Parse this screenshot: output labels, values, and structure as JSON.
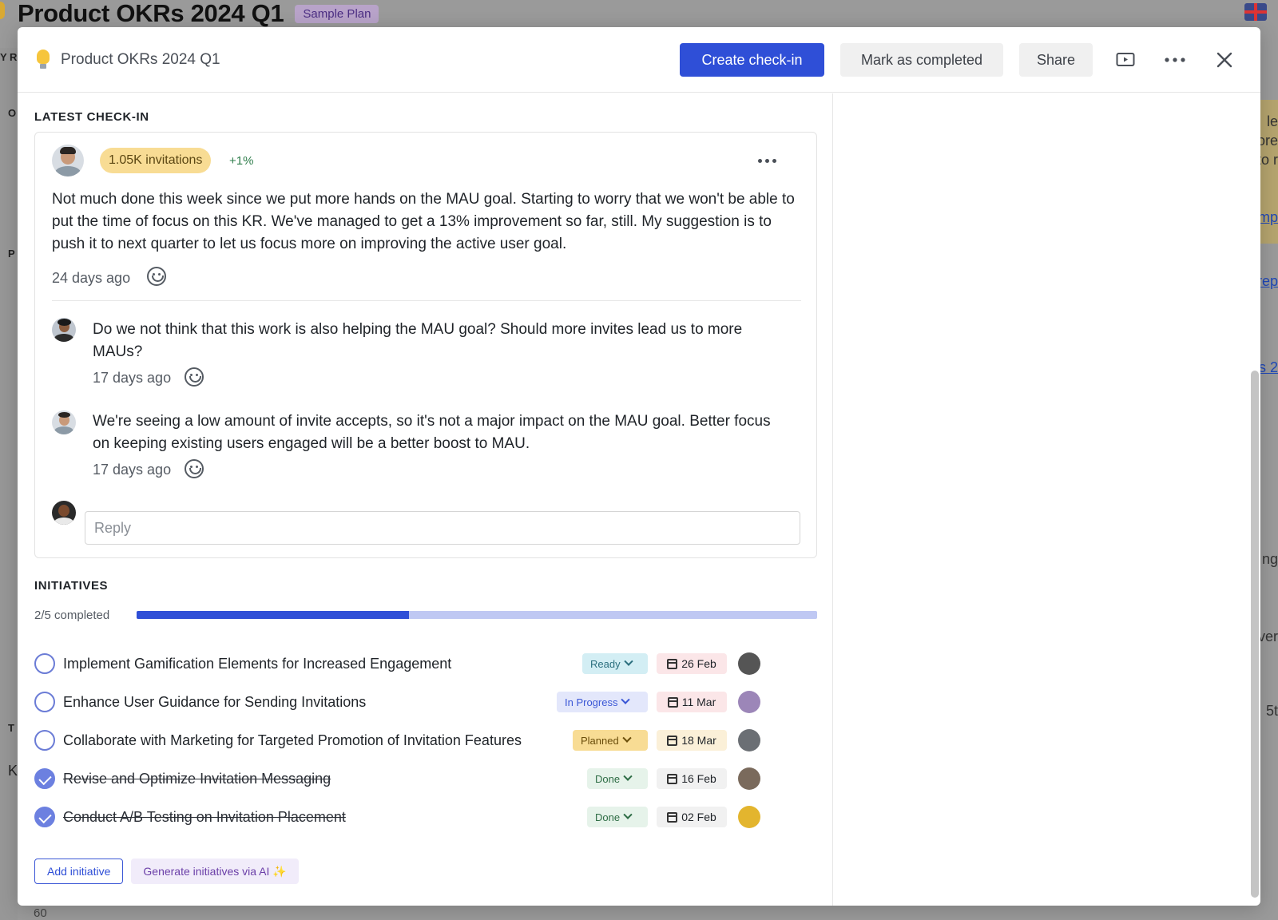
{
  "background": {
    "title": "Product OKRs 2024 Q1",
    "badge": "Sample Plan",
    "bottom_number": "60",
    "left_fragments": [
      "Y R",
      "O",
      "P",
      "T",
      "K"
    ],
    "right_fragments": [
      "le",
      "ore",
      "to r",
      "mp",
      "rep",
      "s 2",
      "ng",
      "ver",
      "5t"
    ]
  },
  "modal": {
    "title": "Product OKRs 2024 Q1",
    "create_checkin_label": "Create check-in",
    "mark_completed_label": "Mark as completed",
    "share_label": "Share"
  },
  "latest_checkin": {
    "section_label": "LATEST CHECK-IN",
    "metric_pill": "1.05K invitations",
    "delta": "+1%",
    "text": "Not much done this week since we put more hands on the MAU goal. Starting to worry that we won't be able to put the time of focus on this KR. We've managed to get a 13% improvement so far, still. My suggestion is to push it to next quarter to let us focus more on improving the active user goal.",
    "time": "24 days ago",
    "replies": [
      {
        "text": "Do we not think that this work is also helping the MAU goal? Should more invites lead us to more MAUs?",
        "time": "17 days ago"
      },
      {
        "text": "We're seeing a low amount of invite accepts, so it's not a major impact on the MAU goal. Better focus on keeping existing users engaged will be a better boost to MAU.",
        "time": "17 days ago"
      }
    ],
    "reply_placeholder": "Reply"
  },
  "initiatives": {
    "section_label": "INITIATIVES",
    "progress_label": "2/5 completed",
    "progress_fraction": 0.4,
    "items": [
      {
        "title": "Implement Gamification Elements for Increased Engagement",
        "status": "Ready",
        "date": "26 Feb",
        "done": false
      },
      {
        "title": "Enhance User Guidance for Sending Invitations",
        "status": "In Progress",
        "date": "11 Mar",
        "done": false
      },
      {
        "title": "Collaborate with Marketing for Targeted Promotion of Invitation Features",
        "status": "Planned",
        "date": "18 Mar",
        "done": false
      },
      {
        "title": "Revise and Optimize Invitation Messaging",
        "status": "Done",
        "date": "16 Feb",
        "done": true
      },
      {
        "title": "Conduct A/B Testing on Invitation Placement",
        "status": "Done",
        "date": "02 Feb",
        "done": true
      }
    ],
    "add_label": "Add initiative",
    "generate_label": "Generate initiatives via AI ✨"
  },
  "colors": {
    "primary": "#2f4fd7",
    "ready_bg": "#d3eef4",
    "ready_fg": "#2b6f7e",
    "in_progress_bg": "#e3e7fb",
    "in_progress_fg": "#3b57d6",
    "planned_bg": "#f8dc94",
    "planned_fg": "#6b4e0b",
    "done_bg": "#e6f3ea",
    "done_fg": "#2e6d45",
    "date_overdue_bg": "#fbe6e8",
    "date_future_bg": "#fbf0d8",
    "date_neutral_bg": "#f1f1f1"
  }
}
